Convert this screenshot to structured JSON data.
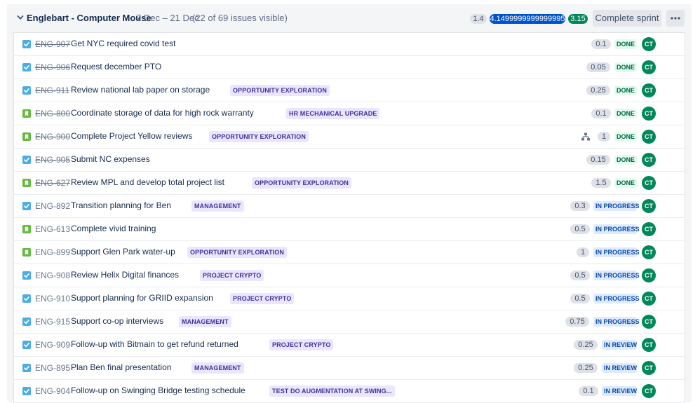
{
  "sprint": {
    "name": "Englebart - Computer Mouse",
    "dates": "7 Dec – 21 Dec",
    "visible_text": "(22 of 69 issues visible)",
    "estimate_todo": "1.4",
    "estimate_in_progress": "4.1499999999999995",
    "estimate_done": "3.15",
    "complete_label": "Complete sprint",
    "more_icon": "more-icon",
    "collapse_icon": "chevron-down-icon"
  },
  "colors": {
    "done": "#00875a",
    "in_progress": "#0052cc",
    "epic_bg": "#eae6ff",
    "epic_text": "#403294",
    "task_icon": "#4bade8",
    "story_icon": "#63ba3c"
  },
  "issues": [
    {
      "type": "task",
      "key": "ENG-907",
      "summary": "Get NYC required covid test",
      "epic": "",
      "estimate": "0.1",
      "status": "DONE",
      "assignee": "CT",
      "subtasks": false
    },
    {
      "type": "task",
      "key": "ENG-906",
      "summary": "Request december PTO",
      "epic": "",
      "estimate": "0.05",
      "status": "DONE",
      "assignee": "CT",
      "subtasks": false
    },
    {
      "type": "task",
      "key": "ENG-911",
      "summary": "Review national lab paper on storage",
      "epic": "OPPORTUNITY EXPLORATION",
      "estimate": "0.25",
      "status": "DONE",
      "assignee": "CT",
      "subtasks": false
    },
    {
      "type": "story",
      "key": "ENG-800",
      "summary": "Coordinate storage of data for high rock warranty",
      "epic": "HR MECHANICAL UPGRADE",
      "estimate": "0.1",
      "status": "DONE",
      "assignee": "CT",
      "subtasks": false
    },
    {
      "type": "story",
      "key": "ENG-900",
      "summary": "Complete Project Yellow reviews",
      "epic": "OPPORTUNITY EXPLORATION",
      "estimate": "1",
      "status": "DONE",
      "assignee": "CT",
      "subtasks": true
    },
    {
      "type": "task",
      "key": "ENG-905",
      "summary": "Submit NC expenses",
      "epic": "",
      "estimate": "0.15",
      "status": "DONE",
      "assignee": "CT",
      "subtasks": false
    },
    {
      "type": "story",
      "key": "ENG-627",
      "summary": "Review MPL and develop total project list",
      "epic": "OPPORTUNITY EXPLORATION",
      "estimate": "1.5",
      "status": "DONE",
      "assignee": "CT",
      "subtasks": false
    },
    {
      "type": "task",
      "key": "ENG-892",
      "summary": "Transition planning for Ben",
      "epic": "MANAGEMENT",
      "estimate": "0.3",
      "status": "IN PROGRESS",
      "assignee": "CT",
      "subtasks": false
    },
    {
      "type": "story",
      "key": "ENG-613",
      "summary": "Complete vivid training",
      "epic": "",
      "estimate": "0.5",
      "status": "IN PROGRESS",
      "assignee": "CT",
      "subtasks": false
    },
    {
      "type": "story",
      "key": "ENG-899",
      "summary": "Support Glen Park water-up",
      "epic": "OPPORTUNITY EXPLORATION",
      "estimate": "1",
      "status": "IN PROGRESS",
      "assignee": "CT",
      "subtasks": false
    },
    {
      "type": "task",
      "key": "ENG-908",
      "summary": "Review Helix Digital finances",
      "epic": "PROJECT CRYPTO",
      "estimate": "0.5",
      "status": "IN PROGRESS",
      "assignee": "CT",
      "subtasks": false
    },
    {
      "type": "task",
      "key": "ENG-910",
      "summary": "Support planning for GRIID expansion",
      "epic": "PROJECT CRYPTO",
      "estimate": "0.5",
      "status": "IN PROGRESS",
      "assignee": "CT",
      "subtasks": false
    },
    {
      "type": "task",
      "key": "ENG-915",
      "summary": "Support co-op interviews",
      "epic": "MANAGEMENT",
      "estimate": "0.75",
      "status": "IN PROGRESS",
      "assignee": "CT",
      "subtasks": false
    },
    {
      "type": "task",
      "key": "ENG-909",
      "summary": "Follow-up with Bitmain to get refund returned",
      "epic": "PROJECT CRYPTO",
      "estimate": "0.25",
      "status": "IN REVIEW",
      "assignee": "CT",
      "subtasks": false
    },
    {
      "type": "task",
      "key": "ENG-895",
      "summary": "Plan Ben final presentation",
      "epic": "MANAGEMENT",
      "estimate": "0.25",
      "status": "IN REVIEW",
      "assignee": "CT",
      "subtasks": false
    },
    {
      "type": "task",
      "key": "ENG-904",
      "summary": "Follow-up on Swinging Bridge testing schedule",
      "epic": "TEST DO AUGMENTATION AT SWING...",
      "estimate": "0.1",
      "status": "IN REVIEW",
      "assignee": "CT",
      "subtasks": false
    }
  ]
}
